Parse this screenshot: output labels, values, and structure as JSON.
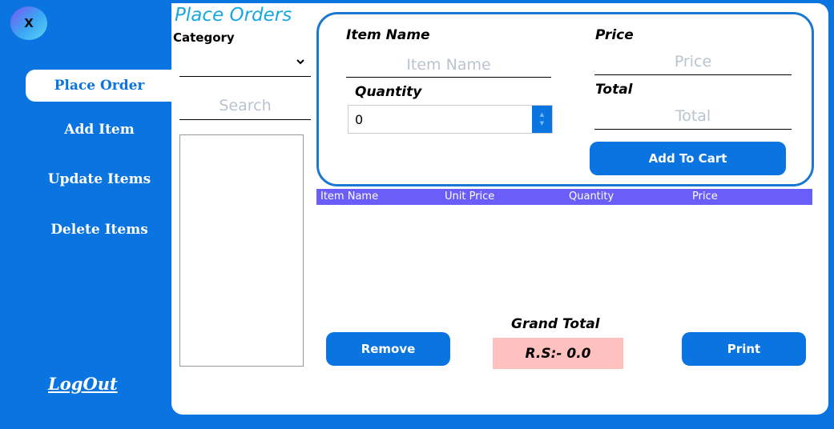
{
  "sidebar": {
    "close_label": "X",
    "items": [
      {
        "label": "Place Order"
      },
      {
        "label": "Add Item"
      },
      {
        "label": "Update Items"
      },
      {
        "label": "Delete Items"
      }
    ],
    "logout_label": "LogOut"
  },
  "main": {
    "title": "Place Orders",
    "category_label": "Category",
    "category_value": "",
    "search_placeholder": "Search"
  },
  "form": {
    "item_name_label": "Item Name",
    "item_name_placeholder": "Item Name",
    "price_label": "Price",
    "price_placeholder": "Price",
    "quantity_label": "Quantity",
    "quantity_value": "0",
    "total_label": "Total",
    "total_placeholder": "Total",
    "add_to_cart_label": "Add To Cart"
  },
  "cart_table": {
    "columns": [
      "Item Name",
      "Unit Price",
      "Quantity",
      "Price"
    ],
    "rows": []
  },
  "footer": {
    "remove_label": "Remove",
    "grand_total_label": "Grand Total",
    "grand_total_value": "R.S:- 0.0",
    "print_label": "Print"
  },
  "colors": {
    "primary": "#0a74e0",
    "title": "#18a8e0",
    "table_header": "#6b5ef8",
    "grand_total_bg": "#ffc0c0"
  }
}
